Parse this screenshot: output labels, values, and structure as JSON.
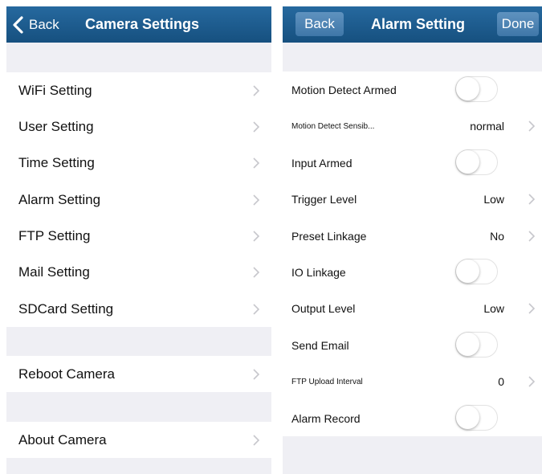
{
  "left": {
    "back_label": "Back",
    "title": "Camera Settings",
    "rows": [
      {
        "label": "WiFi Setting"
      },
      {
        "label": "User Setting"
      },
      {
        "label": "Time Setting"
      },
      {
        "label": "Alarm Setting"
      },
      {
        "label": "FTP Setting"
      },
      {
        "label": "Mail Setting"
      },
      {
        "label": "SDCard Setting"
      },
      {
        "label": "Reboot Camera"
      },
      {
        "label": "About Camera"
      }
    ]
  },
  "right": {
    "back_label": "Back",
    "title": "Alarm Setting",
    "done_label": "Done",
    "rows": [
      {
        "label": "Motion Detect Armed",
        "toggle": "off"
      },
      {
        "label": "Motion Detect Sensib...",
        "value": "normal"
      },
      {
        "label": "Input Armed",
        "toggle": "off"
      },
      {
        "label": "Trigger Level",
        "value": "Low"
      },
      {
        "label": "Preset Linkage",
        "value": "No"
      },
      {
        "label": "IO Linkage",
        "toggle": "off"
      },
      {
        "label": "Output Level",
        "value": "Low"
      },
      {
        "label": "Send Email",
        "toggle": "off"
      },
      {
        "label": "FTP Upload Interval",
        "value": "0"
      },
      {
        "label": "Alarm Record",
        "toggle": "off"
      }
    ]
  },
  "colors": {
    "navbar": "#1e5f94",
    "group_background": "#efeff4",
    "chevron": "#c7c7cc"
  },
  "icons": {
    "back": "chevron-left-icon",
    "disclosure": "chevron-right-icon"
  }
}
